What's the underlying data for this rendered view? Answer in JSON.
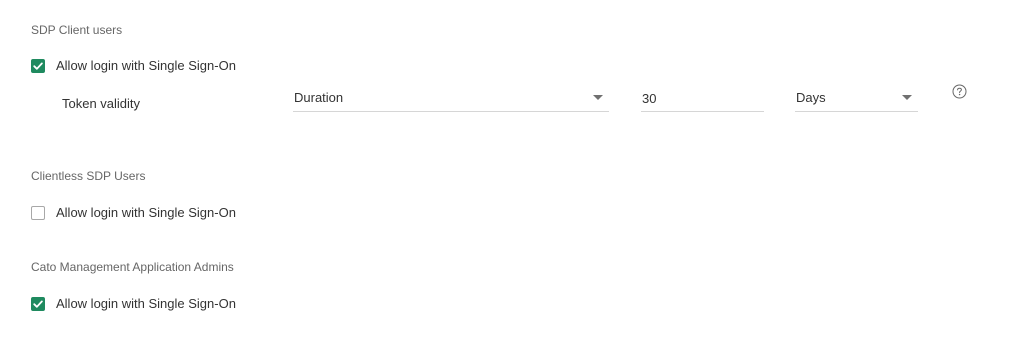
{
  "sdp_client": {
    "title": "SDP Client users",
    "sso_label": "Allow login with Single Sign-On",
    "sso_checked": true,
    "token_validity_label": "Token validity",
    "mode_select": "Duration",
    "amount": "30",
    "unit_select": "Days",
    "help_icon": "question-circle-icon"
  },
  "clientless": {
    "title": "Clientless SDP Users",
    "sso_label": "Allow login with Single Sign-On",
    "sso_checked": false
  },
  "cato_admins": {
    "title": "Cato Management Application Admins",
    "sso_label": "Allow login with Single Sign-On",
    "sso_checked": true
  },
  "colors": {
    "accent": "#1f8a5f"
  }
}
